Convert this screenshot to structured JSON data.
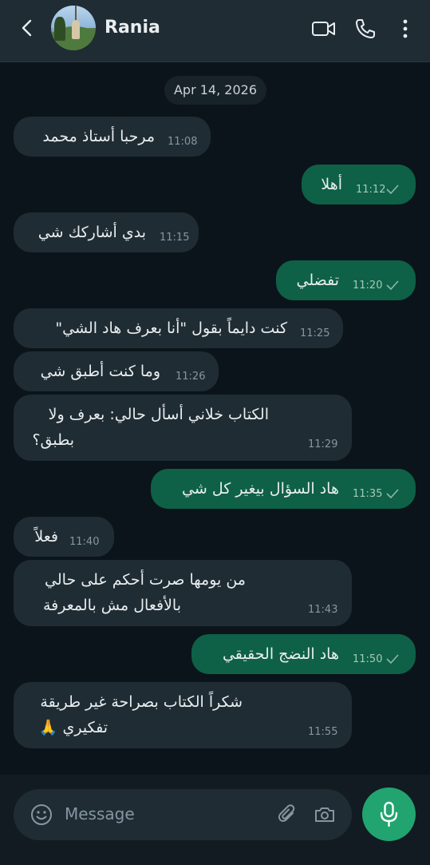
{
  "header": {
    "contact_name": "Rania",
    "icons": [
      "back-arrow-icon",
      "video-call-icon",
      "phone-icon",
      "more-vertical-icon"
    ]
  },
  "date_separator": "Apr 14, 2026",
  "messages": [
    {
      "dir": "in",
      "text": "مرحبا أستاذ محمد",
      "time": "11:08"
    },
    {
      "dir": "out",
      "text": "أهلا",
      "time": "11:12"
    },
    {
      "dir": "in",
      "text": "بدي أشاركك شي",
      "time": "11:15"
    },
    {
      "dir": "out",
      "text": "تفضلي",
      "time": "11:20"
    },
    {
      "dir": "in",
      "text": "كنت دايماً بقول \"أنا بعرف هاد الشي\"",
      "time": "11:25"
    },
    {
      "dir": "in",
      "text": "وما كنت أطبق شي",
      "time": "11:26"
    },
    {
      "dir": "in",
      "text": "الكتاب خلاني أسأل حالي: بعرف ولا",
      "text2": "بطبق؟",
      "time": "11:29"
    },
    {
      "dir": "out",
      "text": "هاد السؤال بيغير كل شي",
      "time": "11:35"
    },
    {
      "dir": "in",
      "text": "فعلاً",
      "time": "11:40"
    },
    {
      "dir": "in",
      "text": "من يومها صرت أحكم على حالي",
      "text2": "بالأفعال مش بالمعرفة",
      "time": "11:43"
    },
    {
      "dir": "out",
      "text": "هاد النضج الحقيقي",
      "time": "11:50"
    },
    {
      "dir": "in",
      "text": "شكراً الكتاب بصراحة غير طريقة",
      "text2": "تفكيري 🙏",
      "time": "11:55"
    }
  ],
  "composer": {
    "placeholder": "Message",
    "icons": [
      "emoji-icon",
      "attach-icon",
      "camera-icon",
      "mic-icon"
    ]
  },
  "colors": {
    "background": "#0b141a",
    "incoming_bubble": "#1f2c34",
    "outgoing_bubble": "#0e6146",
    "accent": "#21a46f"
  }
}
